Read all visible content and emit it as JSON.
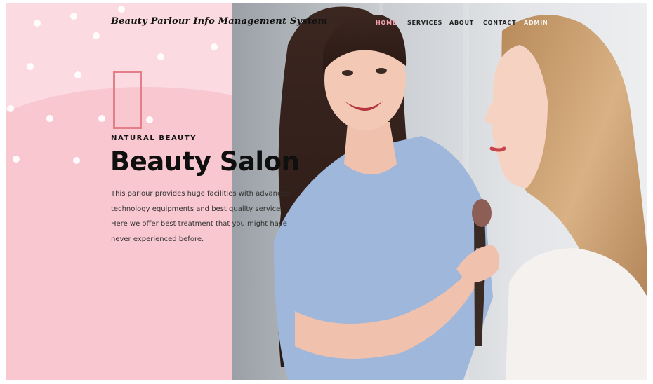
{
  "header": {
    "brand": "Beauty Parlour Info Management System",
    "nav": [
      {
        "label": "HOME",
        "active": true
      },
      {
        "label": "SERVICES",
        "active": false
      },
      {
        "label": "ABOUT",
        "active": false
      },
      {
        "label": "CONTACT",
        "active": false
      },
      {
        "label": "ADMIN",
        "active": false
      }
    ]
  },
  "hero": {
    "kicker": "NATURAL BEAUTY",
    "title": "Beauty Salon",
    "description": "This parlour provides huge facilities with advanced technology equipments and best quality service. Here we offer best treatment that you might have never experienced before.",
    "image_alt": "Makeup artist applying makeup to a woman"
  },
  "colors": {
    "accent_pink": "#f3a4b0",
    "panel_pink": "#f8c7d0",
    "frame_red": "#e47f89"
  }
}
